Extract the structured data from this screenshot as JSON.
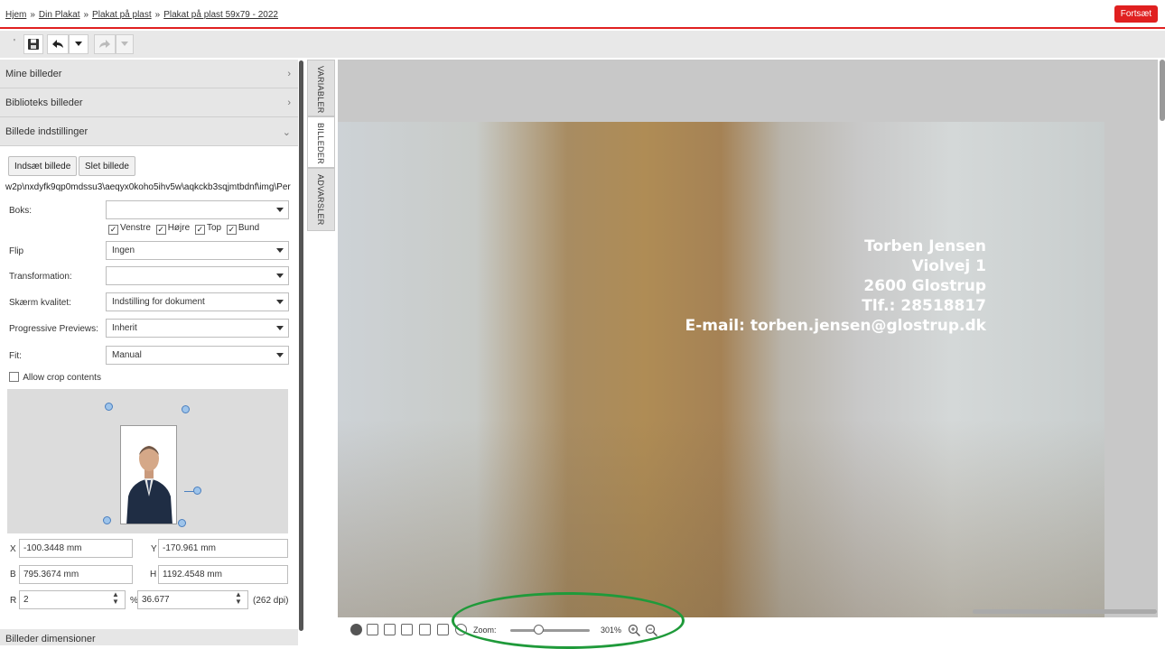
{
  "breadcrumb": {
    "items": [
      "Hjem",
      "Din Plakat",
      "Plakat på plast",
      "Plakat på plast 59x79 - 2022"
    ],
    "separator": "»"
  },
  "topbar": {
    "continue_label": "Fortsæt",
    "accent_color": "#e02020"
  },
  "toolbar": {
    "dot": "'",
    "icons": [
      "save-icon",
      "undo-icon",
      "undo-dropdown-icon",
      "redo-icon",
      "redo-dropdown-icon"
    ]
  },
  "left_panel": {
    "sections": [
      {
        "label": "Mine billeder",
        "chevron": "›"
      },
      {
        "label": "Biblioteks billeder",
        "chevron": "›"
      },
      {
        "label": "Billede indstillinger",
        "chevron": "⌄"
      }
    ],
    "insert_image_label": "Indsæt billede",
    "delete_image_label": "Slet billede",
    "image_path": "w2p\\nxdyfk9qp0mdssu3\\aeqyx0koho5ihv5w\\aqkckb3sqjmtbdnf\\img\\Per",
    "box": {
      "label": "Boks:",
      "value": ""
    },
    "checkboxes": [
      {
        "label": "Venstre",
        "checked": true
      },
      {
        "label": "Højre",
        "checked": true
      },
      {
        "label": "Top",
        "checked": true
      },
      {
        "label": "Bund",
        "checked": true
      }
    ],
    "flip": {
      "label": "Flip",
      "value": "Ingen"
    },
    "transformation": {
      "label": "Transformation:",
      "value": ""
    },
    "screen_quality": {
      "label": "Skærm kvalitet:",
      "value": "Indstilling for dokument"
    },
    "progressive_previews": {
      "label": "Progressive Previews:",
      "value": "Inherit"
    },
    "fit": {
      "label": "Fit:",
      "value": "Manual"
    },
    "allow_crop": {
      "label": "Allow crop contents",
      "checked": false
    },
    "x": {
      "label": "X",
      "value": "-100.3448 mm"
    },
    "y": {
      "label": "Y",
      "value": "-170.961 mm"
    },
    "b": {
      "label": "B",
      "value": "795.3674 mm"
    },
    "h": {
      "label": "H",
      "value": "1192.4548 mm"
    },
    "r": {
      "label": "R",
      "value": "2"
    },
    "percent_sign": "%",
    "scale": {
      "value": "36.677"
    },
    "dpi": "(262 dpi)",
    "bottom_section": "Billeder dimensioner"
  },
  "side_tabs": [
    {
      "label": "VARIABLER",
      "active": false
    },
    {
      "label": "BILLEDER",
      "active": true
    },
    {
      "label": "ADVARSLER",
      "active": false
    }
  ],
  "poster": {
    "lines": [
      "Torben Jensen",
      "Violvej 1",
      "2600 Glostrup",
      "Tlf.: 28518817",
      "E-mail: torben.jensen@glostrup.dk"
    ]
  },
  "zoom": {
    "label": "Zoom:",
    "value": "301%",
    "level": 0.3
  },
  "bottom_icons": [
    "settings-icon",
    "page-icon",
    "fit-page-icon",
    "fit-width-icon",
    "horizontal-fit-icon",
    "vertical-fit-icon",
    "pan-icon",
    "zoom-in-icon",
    "zoom-out-icon"
  ]
}
